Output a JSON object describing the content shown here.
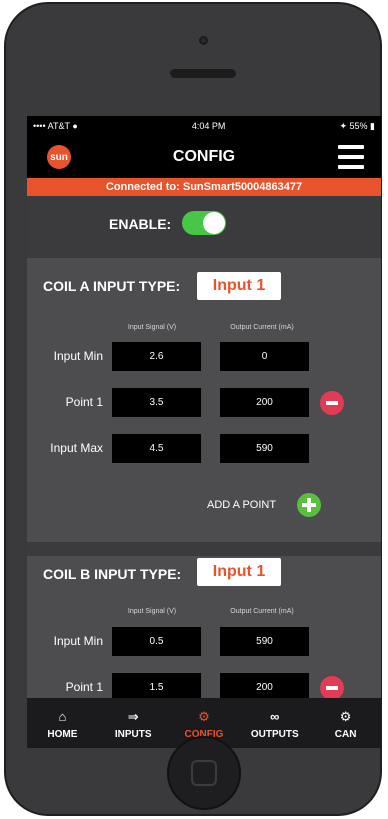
{
  "status": {
    "carrier": "AT&T",
    "time": "4:04 PM",
    "battery": "55%"
  },
  "nav": {
    "logo_text": "sun",
    "title": "CONFIG"
  },
  "connection": {
    "text": "Connected to: SunSmart50004863477"
  },
  "enable": {
    "label": "ENABLE:",
    "on": true
  },
  "coil_a": {
    "label": "COIL A INPUT TYPE:",
    "type": "Input 1",
    "col_input": "Input Signal (V)",
    "col_output": "Output Current (mA)",
    "rows": [
      {
        "label": "Input Min",
        "signal": "2.6",
        "current": "0"
      },
      {
        "label": "Point 1",
        "signal": "3.5",
        "current": "200"
      },
      {
        "label": "Input Max",
        "signal": "4.5",
        "current": "590"
      }
    ],
    "add_point": "ADD A POINT"
  },
  "coil_b": {
    "label": "COIL B INPUT TYPE:",
    "type": "Input 1",
    "col_input": "Input Signal (V)",
    "col_output": "Output Current (mA)",
    "rows": [
      {
        "label": "Input Min",
        "signal": "0.5",
        "current": "590"
      },
      {
        "label": "Point 1",
        "signal": "1.5",
        "current": "200"
      }
    ]
  },
  "tabs": [
    {
      "label": "HOME",
      "icon": "home-icon"
    },
    {
      "label": "INPUTS",
      "icon": "inputs-icon"
    },
    {
      "label": "CONFIG",
      "icon": "gear-icon"
    },
    {
      "label": "OUTPUTS",
      "icon": "outputs-icon"
    },
    {
      "label": "CAN",
      "icon": "can-icon"
    }
  ],
  "colors": {
    "accent": "#e8532c",
    "toggle_on": "#47c745",
    "minus": "#e23c55",
    "plus": "#58c03d"
  }
}
